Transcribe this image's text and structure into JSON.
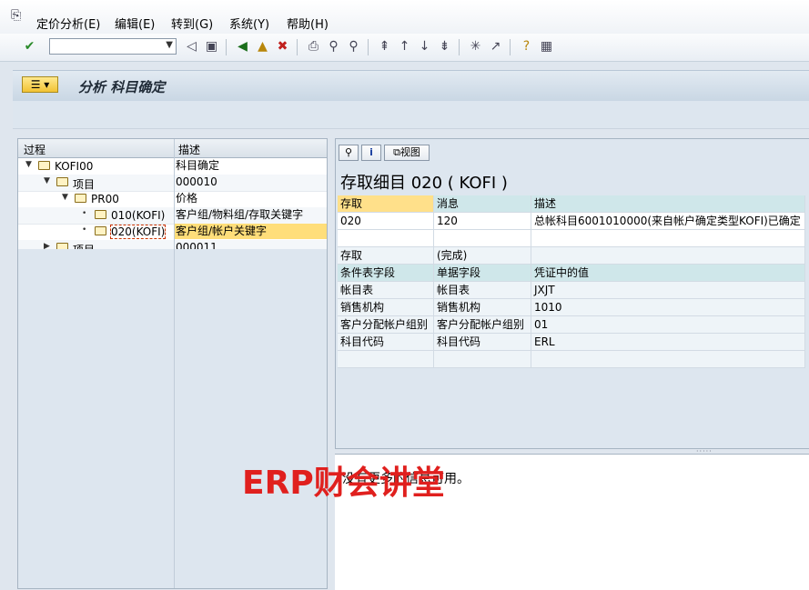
{
  "menu": [
    "定价分析(E)",
    "编辑(E)",
    "转到(G)",
    "系统(Y)",
    "帮助(H)"
  ],
  "title": "分析 科目确定",
  "tree": {
    "headers": [
      "过程",
      "描述"
    ],
    "rows": [
      {
        "proc": "KOFI00",
        "desc": "科目确定"
      },
      {
        "proc": "项目",
        "desc": "000010"
      },
      {
        "proc": "PR00",
        "desc": "价格"
      },
      {
        "proc": "010(KOFI)",
        "desc": "客户组/物料组/存取关键字"
      },
      {
        "proc": "020(KOFI)",
        "desc": "客户组/帐户关键字"
      },
      {
        "proc": "项目",
        "desc": "000011"
      }
    ]
  },
  "detail": {
    "view_button": "视图",
    "title": "存取细目 020 ( KOFI )",
    "headers": [
      "存取",
      "消息",
      "描述"
    ],
    "message_row": [
      "020",
      "120",
      "总帐科目6001010000(来自帐户确定类型KOFI)已确定"
    ],
    "access_row": [
      "存取",
      "(完成)",
      ""
    ],
    "field_headers": [
      "条件表字段",
      "单据字段",
      "凭证中的值"
    ],
    "fields": [
      [
        "帐目表",
        "帐目表",
        "JXJT"
      ],
      [
        "销售机构",
        "销售机构",
        "1010"
      ],
      [
        "客户分配帐户组别",
        "客户分配帐户组别",
        "01"
      ],
      [
        "科目代码",
        "科目代码",
        "ERL"
      ]
    ]
  },
  "bottom_text": "没有更多的信息可用。",
  "watermark": "ERP财会讲堂"
}
